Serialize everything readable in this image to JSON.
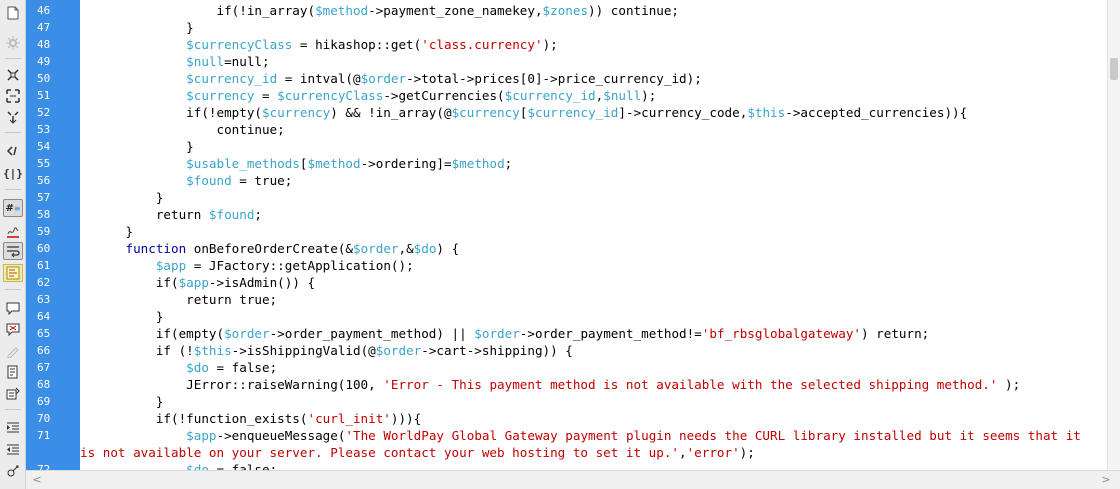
{
  "toolbar": {
    "icons": [
      "file-icon",
      "settings-icon",
      "collapse-icon",
      "expand-icon",
      "select-icon",
      "code-hint-icon",
      "braces-icon",
      "line-numbers-icon",
      "highlight-invalid-icon",
      "word-wrap-icon",
      "syntax-color-icon",
      "comment-icon",
      "uncomment-icon",
      "wrap-tag-icon",
      "recent-snippets-icon",
      "move-css-icon",
      "indent-icon",
      "outdent-icon",
      "format-icon"
    ]
  },
  "editor": {
    "gutter_color": "#3a8ee6",
    "lines": [
      {
        "num": "46",
        "tokens": [
          [
            "plain",
            "            if(!in_array("
          ],
          [
            "var",
            "$method"
          ],
          [
            "plain",
            "->payment_zone_namekey,"
          ],
          [
            "var",
            "$zones"
          ],
          [
            "plain",
            ")) continue;"
          ]
        ]
      },
      {
        "num": "47",
        "tokens": [
          [
            "plain",
            "        }"
          ]
        ]
      },
      {
        "num": "48",
        "tokens": [
          [
            "plain",
            "        "
          ],
          [
            "var",
            "$currencyClass"
          ],
          [
            "plain",
            " = hikashop::get("
          ],
          [
            "str",
            "'class.currency'"
          ],
          [
            "plain",
            ");"
          ]
        ]
      },
      {
        "num": "49",
        "tokens": [
          [
            "plain",
            "        "
          ],
          [
            "var",
            "$null"
          ],
          [
            "plain",
            "=null;"
          ]
        ]
      },
      {
        "num": "50",
        "tokens": [
          [
            "plain",
            "        "
          ],
          [
            "var",
            "$currency_id"
          ],
          [
            "plain",
            " = intval(@"
          ],
          [
            "var",
            "$order"
          ],
          [
            "plain",
            "->total->prices[0]->price_currency_id);"
          ]
        ]
      },
      {
        "num": "51",
        "tokens": [
          [
            "plain",
            "        "
          ],
          [
            "var",
            "$currency"
          ],
          [
            "plain",
            " = "
          ],
          [
            "var",
            "$currencyClass"
          ],
          [
            "plain",
            "->getCurrencies("
          ],
          [
            "var",
            "$currency_id"
          ],
          [
            "plain",
            ","
          ],
          [
            "var",
            "$null"
          ],
          [
            "plain",
            ");"
          ]
        ]
      },
      {
        "num": "52",
        "tokens": [
          [
            "plain",
            "        if(!empty("
          ],
          [
            "var",
            "$currency"
          ],
          [
            "plain",
            ") && !in_array(@"
          ],
          [
            "var",
            "$currency"
          ],
          [
            "plain",
            "["
          ],
          [
            "var",
            "$currency_id"
          ],
          [
            "plain",
            "]->currency_code,"
          ],
          [
            "var",
            "$this"
          ],
          [
            "plain",
            "->accepted_currencies)){"
          ]
        ]
      },
      {
        "num": "53",
        "tokens": [
          [
            "plain",
            "            continue;"
          ]
        ]
      },
      {
        "num": "54",
        "tokens": [
          [
            "plain",
            "        }"
          ]
        ]
      },
      {
        "num": "55",
        "tokens": [
          [
            "plain",
            "        "
          ],
          [
            "var",
            "$usable_methods"
          ],
          [
            "plain",
            "["
          ],
          [
            "var",
            "$method"
          ],
          [
            "plain",
            "->ordering]="
          ],
          [
            "var",
            "$method"
          ],
          [
            "plain",
            ";"
          ]
        ]
      },
      {
        "num": "56",
        "tokens": [
          [
            "plain",
            "        "
          ],
          [
            "var",
            "$found"
          ],
          [
            "plain",
            " = true;"
          ]
        ]
      },
      {
        "num": "57",
        "tokens": [
          [
            "plain",
            "    }"
          ]
        ]
      },
      {
        "num": "58",
        "tokens": [
          [
            "plain",
            "    return "
          ],
          [
            "var",
            "$found"
          ],
          [
            "plain",
            ";"
          ]
        ]
      },
      {
        "num": "59",
        "tokens": [
          [
            "plain",
            "}"
          ]
        ]
      },
      {
        "num": "60",
        "tokens": [
          [
            "kw",
            "function"
          ],
          [
            "plain",
            " onBeforeOrderCreate(&"
          ],
          [
            "var",
            "$order"
          ],
          [
            "plain",
            ",&"
          ],
          [
            "var",
            "$do"
          ],
          [
            "plain",
            ") {"
          ]
        ]
      },
      {
        "num": "61",
        "tokens": [
          [
            "plain",
            "    "
          ],
          [
            "var",
            "$app"
          ],
          [
            "plain",
            " = JFactory::getApplication();"
          ]
        ]
      },
      {
        "num": "62",
        "tokens": [
          [
            "plain",
            "    if("
          ],
          [
            "var",
            "$app"
          ],
          [
            "plain",
            "->isAdmin()) {"
          ]
        ]
      },
      {
        "num": "63",
        "tokens": [
          [
            "plain",
            "        return true;"
          ]
        ]
      },
      {
        "num": "64",
        "tokens": [
          [
            "plain",
            "    }"
          ]
        ]
      },
      {
        "num": "65",
        "tokens": [
          [
            "plain",
            "    if(empty("
          ],
          [
            "var",
            "$order"
          ],
          [
            "plain",
            "->order_payment_method) || "
          ],
          [
            "var",
            "$order"
          ],
          [
            "plain",
            "->order_payment_method!="
          ],
          [
            "str",
            "'bf_rbsglobalgateway'"
          ],
          [
            "plain",
            ") return;"
          ]
        ]
      },
      {
        "num": "66",
        "tokens": [
          [
            "plain",
            "    if (!"
          ],
          [
            "var",
            "$this"
          ],
          [
            "plain",
            "->isShippingValid(@"
          ],
          [
            "var",
            "$order"
          ],
          [
            "plain",
            "->cart->shipping)) {"
          ]
        ]
      },
      {
        "num": "67",
        "tokens": [
          [
            "plain",
            "        "
          ],
          [
            "var",
            "$do"
          ],
          [
            "plain",
            " = false;"
          ]
        ]
      },
      {
        "num": "68",
        "tokens": [
          [
            "plain",
            "        JError::raiseWarning(100, "
          ],
          [
            "str",
            "'Error - This payment method is not available with the selected shipping method.'"
          ],
          [
            "plain",
            " );"
          ]
        ]
      },
      {
        "num": "69",
        "tokens": [
          [
            "plain",
            "    }"
          ]
        ]
      },
      {
        "num": "70",
        "tokens": [
          [
            "plain",
            "    if(!function_exists("
          ],
          [
            "str",
            "'curl_init'"
          ],
          [
            "plain",
            "))){"
          ]
        ]
      },
      {
        "num": "71",
        "tokens": [
          [
            "plain",
            "        "
          ],
          [
            "var",
            "$app"
          ],
          [
            "plain",
            "->enqueueMessage("
          ],
          [
            "str",
            "'The WorldPay Global Gateway payment plugin needs the CURL library installed but it seems that it"
          ]
        ]
      },
      {
        "num": "",
        "tokens": [
          [
            "str",
            "is not available on your server. Please contact your web hosting to set it up.'"
          ],
          [
            "plain",
            ","
          ],
          [
            "str",
            "'error'"
          ],
          [
            "plain",
            ");"
          ]
        ]
      },
      {
        "num": "72",
        "tokens": [
          [
            "plain",
            "        "
          ],
          [
            "var",
            "$do"
          ],
          [
            "plain",
            " = false;"
          ]
        ]
      }
    ]
  },
  "scrollbar": {
    "left_arrow": "<",
    "right_arrow": ">"
  }
}
